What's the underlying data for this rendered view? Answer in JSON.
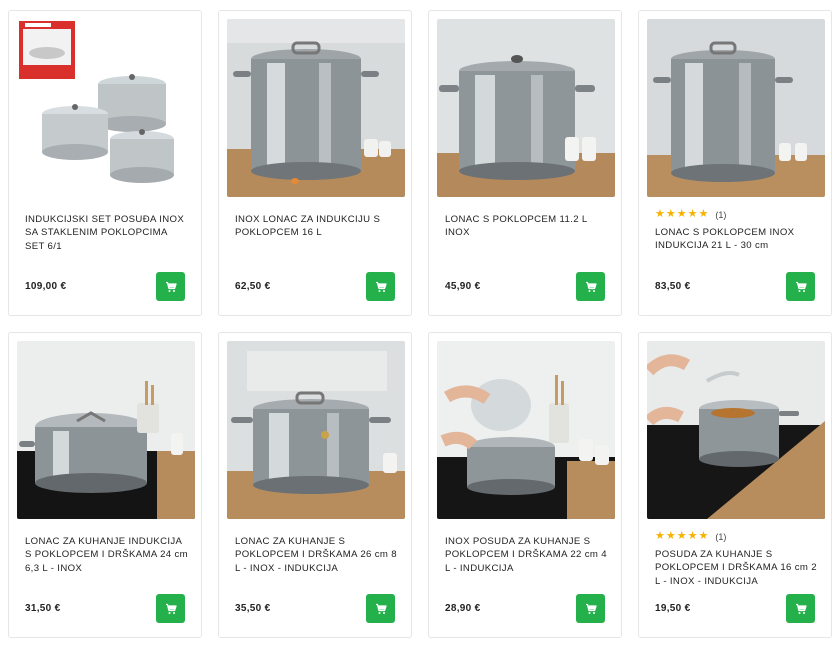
{
  "products": [
    {
      "title": "INDUKCIJSKI SET POSUĐA INOX SA STAKLENIM POKLOPCIMA SET 6/1",
      "price": "109,00 €",
      "rating_count": "",
      "image_icon": "pot-set-icon"
    },
    {
      "title": "INOX LONAC ZA INDUKCIJU S POKLOPCEM 16 L",
      "price": "62,50 €",
      "rating_count": "",
      "image_icon": "stock-pot-icon"
    },
    {
      "title": "LONAC S POKLOPCEM 11.2 L INOX",
      "price": "45,90 €",
      "rating_count": "",
      "image_icon": "stock-pot-icon"
    },
    {
      "title": "LONAC S POKLOPCEM INOX INDUKCIJA 21 L - 30 cm",
      "price": "83,50 €",
      "rating_count": "(1)",
      "stars": 5,
      "image_icon": "stock-pot-icon"
    },
    {
      "title": "LONAC ZA KUHANJE INDUKCIJA S POKLOPCEM I DRŠKAMA 24 cm 6,3 L - INOX",
      "price": "31,50 €",
      "rating_count": "",
      "image_icon": "cooking-pot-icon"
    },
    {
      "title": "LONAC ZA KUHANJE S POKLOPCEM I DRŠKAMA 26 cm 8 L - INOX - INDUKCIJA",
      "price": "35,50 €",
      "rating_count": "",
      "image_icon": "cooking-pot-icon"
    },
    {
      "title": "INOX POSUDA ZA KUHANJE S POKLOPCEM I DRŠKAMA 22 cm 4 L - INDUKCIJA",
      "price": "28,90 €",
      "rating_count": "",
      "image_icon": "cooking-pot-icon"
    },
    {
      "title": "POSUDA ZA KUHANJE S POKLOPCEM I DRŠKAMA 16 cm 2 L - INOX - INDUKCIJA",
      "price": "19,50 €",
      "rating_count": "(1)",
      "stars": 5,
      "image_icon": "cooking-pot-icon"
    }
  ],
  "colors": {
    "cart_button": "#24b04b",
    "star": "#f5b301",
    "card_border": "#e6e6e6"
  },
  "cart_icon": "shopping-cart-icon"
}
